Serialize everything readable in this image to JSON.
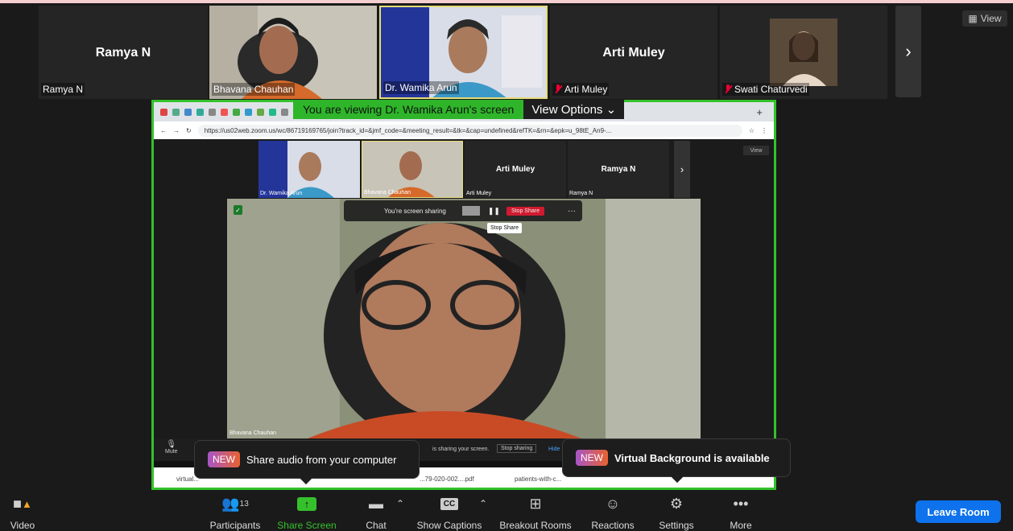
{
  "tiles": {
    "t1": {
      "bigname": "Ramya N",
      "label": "Ramya N"
    },
    "t2": {
      "label": "Bhavana Chauhan"
    },
    "t3": {
      "label": "Dr. Wamika Arun"
    },
    "t4": {
      "bigname": "Arti Muley",
      "label": "Arti Muley"
    },
    "t5": {
      "label": "Swati Chaturvedi"
    }
  },
  "view_label": "View",
  "banner": {
    "message": "You are viewing Dr. Wamika Arun's screen",
    "options": "View Options"
  },
  "browser": {
    "url": "https://us02web.zoom.us/wc/86719169765/join?track_id=&jmf_code=&meeting_result=&tk=&cap=undefined&refTK=&rn=&epk=u_98tE_An9-..."
  },
  "inner": {
    "tiles": {
      "a": {
        "label": "Dr. Wamika Arun"
      },
      "b": {
        "label": "Bhavana Chauhan"
      },
      "c": {
        "bigname": "Arti Muley",
        "label": "Arti Muley"
      },
      "d": {
        "bigname": "Ramya N",
        "label": "Ramya N"
      }
    },
    "view_label": "View",
    "sharebar_text": "You're screen sharing",
    "stop_share": "Stop Share",
    "tooltip": "Stop Share",
    "main_label": "Bhavana Chauhan",
    "mute_label": "Mute",
    "sharing_text": "is sharing your screen.",
    "stop_sharing": "Stop sharing",
    "hide": "Hide",
    "downloads": [
      "virtual...",
      "...79-020-002....pdf",
      "patients-with-c..."
    ]
  },
  "popups": {
    "audio": {
      "badge": "NEW",
      "text": "Share audio from your computer"
    },
    "vb": {
      "badge": "NEW",
      "text": "Virtual Background is available"
    }
  },
  "toolbar": {
    "video": "Video",
    "participants": "Participants",
    "participants_count": "13",
    "share": "Share Screen",
    "chat": "Chat",
    "captions": "Show Captions",
    "breakout": "Breakout Rooms",
    "reactions": "Reactions",
    "settings": "Settings",
    "more": "More",
    "leave": "Leave Room"
  }
}
